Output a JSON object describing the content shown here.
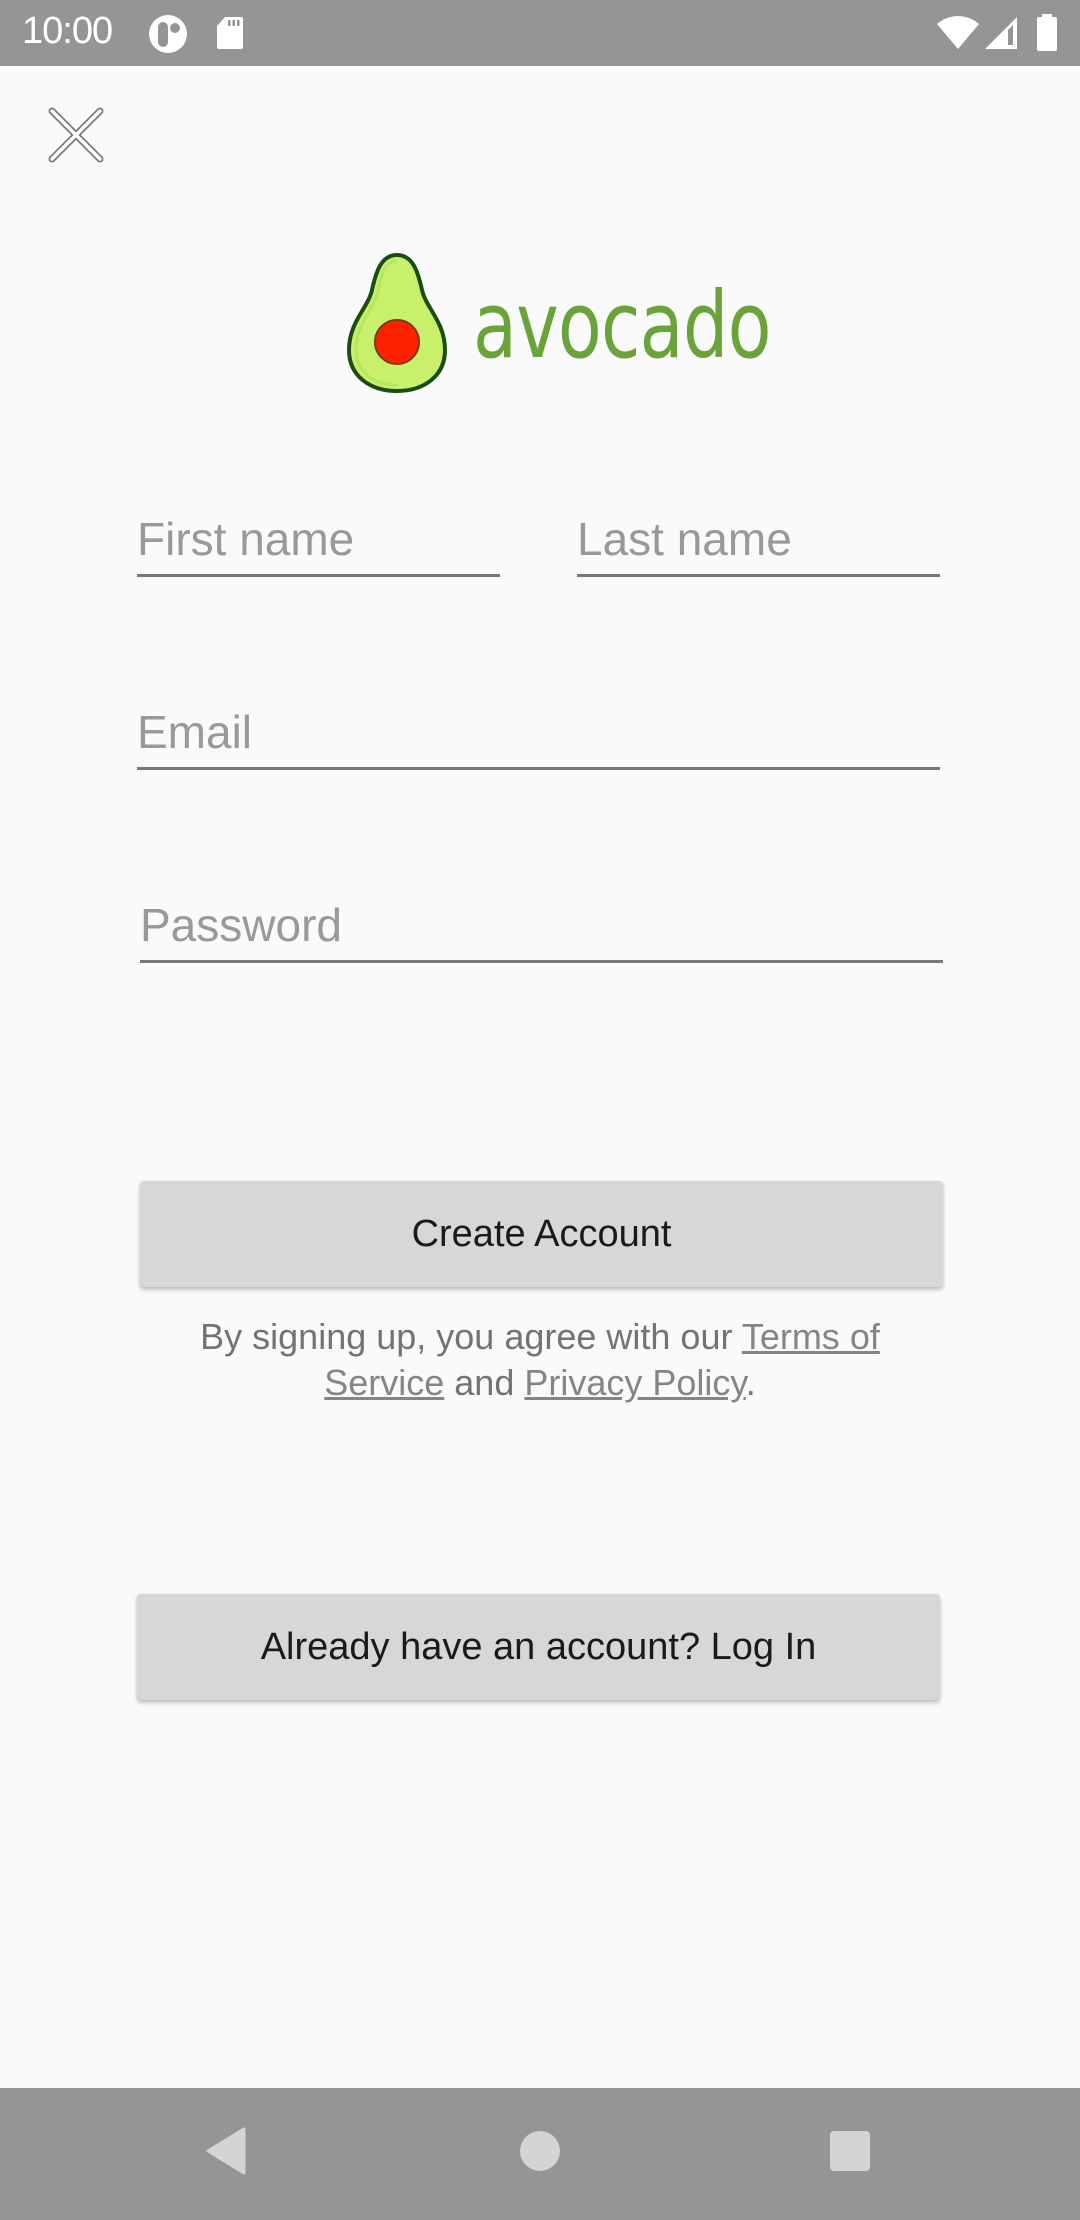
{
  "status_bar": {
    "time": "10:00",
    "left_icons": [
      "notification-app-icon",
      "sd-card-icon"
    ],
    "right_icons": [
      "wifi-icon",
      "cell-signal-icon",
      "battery-icon"
    ]
  },
  "header": {
    "close_icon": "close-icon"
  },
  "logo": {
    "wordmark": "avocado",
    "brand_color": "#6aa33a",
    "flesh_color": "#c8f06a",
    "outline_color": "#1a4d12",
    "pit_color": "#ff2200"
  },
  "form": {
    "first_name": {
      "value": "",
      "placeholder": "First name"
    },
    "last_name": {
      "value": "",
      "placeholder": "Last name"
    },
    "email": {
      "value": "",
      "placeholder": "Email"
    },
    "password": {
      "value": "",
      "placeholder": "Password"
    }
  },
  "actions": {
    "create_account_label": "Create Account",
    "login_label": "Already have an account? Log In"
  },
  "terms": {
    "prefix": "By signing up, you agree with our ",
    "terms_link": "Terms of Service",
    "conjunction": " and ",
    "privacy_link": "Privacy Policy",
    "suffix": "."
  },
  "nav_bar": {
    "buttons": [
      "back",
      "home",
      "recents"
    ]
  }
}
